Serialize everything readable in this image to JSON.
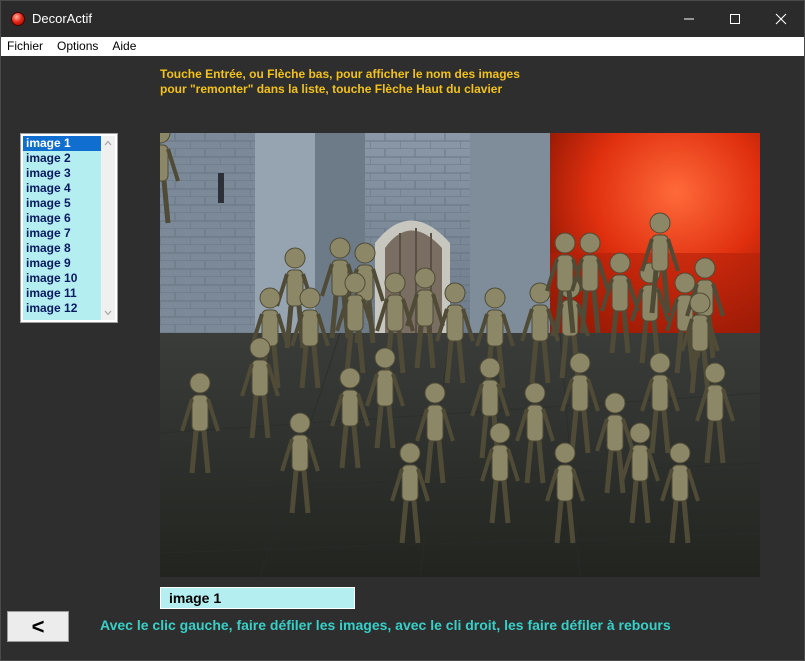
{
  "window": {
    "title": "DecorActif",
    "icons": {
      "app": "red-app-icon",
      "minimize": "minimize-icon",
      "maximize": "maximize-icon",
      "close": "close-icon"
    }
  },
  "menu": {
    "items": [
      {
        "label": "Fichier"
      },
      {
        "label": "Options"
      },
      {
        "label": "Aide"
      }
    ]
  },
  "instructions": {
    "top_line1": "Touche Entrée, ou Flèche bas,  pour afficher le nom des images",
    "top_line2": "pour \"remonter\" dans  la liste, touche Flèche Haut du clavier",
    "bottom": "Avec le clic gauche, faire défiler les images, avec le cli droit, les faire défiler à rebours"
  },
  "image_list": {
    "items": [
      "image 1",
      "image 2",
      "image 3",
      "image 4",
      "image 5",
      "image 6",
      "image 7",
      "image 8",
      "image 9",
      "image 10",
      "image 11",
      "image 12"
    ],
    "selected_index": 0
  },
  "current_image": {
    "name": "image 1",
    "icon": "skeleton-army-castle-picture"
  },
  "back_button": {
    "label": "<"
  },
  "colors": {
    "instruction_top": "#f2c21a",
    "instruction_bottom": "#37d0c8",
    "list_background": "#b4eef0",
    "list_selected": "#0f6ed0"
  }
}
